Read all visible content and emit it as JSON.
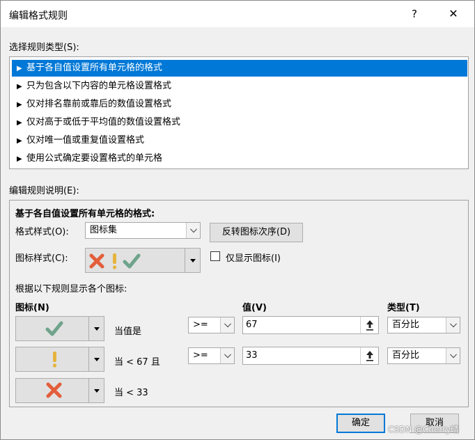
{
  "window": {
    "title": "编辑格式规则",
    "help_glyph": "?",
    "close_glyph": "✕"
  },
  "rule_type": {
    "label": "选择规则类型(S):",
    "items": [
      "基于各自值设置所有单元格的格式",
      "只为包含以下内容的单元格设置格式",
      "仅对排名靠前或靠后的数值设置格式",
      "仅对高于或低于平均值的数值设置格式",
      "仅对唯一值或重复值设置格式",
      "使用公式确定要设置格式的单元格"
    ],
    "selected_index": 0,
    "bullet": "▶"
  },
  "description": {
    "label": "编辑规则说明(E):",
    "heading": "基于各自值设置所有单元格的格式:",
    "format_style_label": "格式样式(O):",
    "format_style_value": "图标集",
    "reverse_button": "反转图标次序(D)",
    "icon_style_label": "图标样式(C):",
    "icon_style_value": [
      "cross-icon",
      "exclamation-icon",
      "checkmark-icon"
    ],
    "show_icon_only_label": "仅显示图标(I)",
    "show_icon_only_checked": false,
    "rules_caption": "根据以下规则显示各个图标:",
    "col_icon": "图标(N)",
    "col_value": "值(V)",
    "col_type": "类型(T)",
    "rows": [
      {
        "icon": "checkmark-icon",
        "condition": "当值是",
        "operator": ">=",
        "value": "67",
        "type": "百分比"
      },
      {
        "icon": "exclamation-icon",
        "condition": "当 < 67 且",
        "operator": ">=",
        "value": "33",
        "type": "百分比"
      },
      {
        "icon": "cross-icon",
        "condition": "当 < 33"
      }
    ]
  },
  "footer": {
    "ok": "确定",
    "cancel": "取消"
  },
  "watermark": "CSDN @Cherry晴",
  "colors": {
    "selection": "#0078d7",
    "check_green": "#6fa38c",
    "exclaim_yellow": "#e6b43c",
    "cross_red": "#e35d3a"
  }
}
